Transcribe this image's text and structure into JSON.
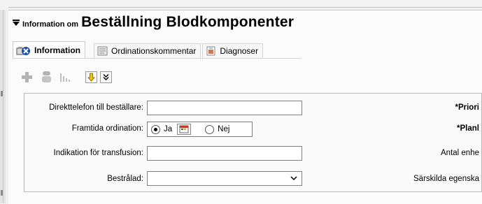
{
  "header": {
    "prefix": "Information om",
    "title": "Beställning Blodkomponenter"
  },
  "tabs": [
    {
      "label": "Information"
    },
    {
      "label": "Ordinationskommentar"
    },
    {
      "label": "Diagnoser"
    }
  ],
  "form": {
    "direkttelefon_label": "Direkttelefon till beställare:",
    "direkttelefon_value": "",
    "framtida_label": "Framtida ordination:",
    "framtida_ja": "Ja",
    "framtida_nej": "Nej",
    "indikation_label": "Indikation för transfusion:",
    "indikation_value": "",
    "bestralad_label": "Bestrålad:",
    "bestralad_value": ""
  },
  "right_labels": {
    "priori": "*Priori",
    "planl": "*Planl",
    "antal": "Antal enhe",
    "sarskilda": "Särskilda egenska"
  },
  "colors": {
    "accent_blue": "#1f4fb3",
    "toolbar_yellow": "#f2c300"
  }
}
